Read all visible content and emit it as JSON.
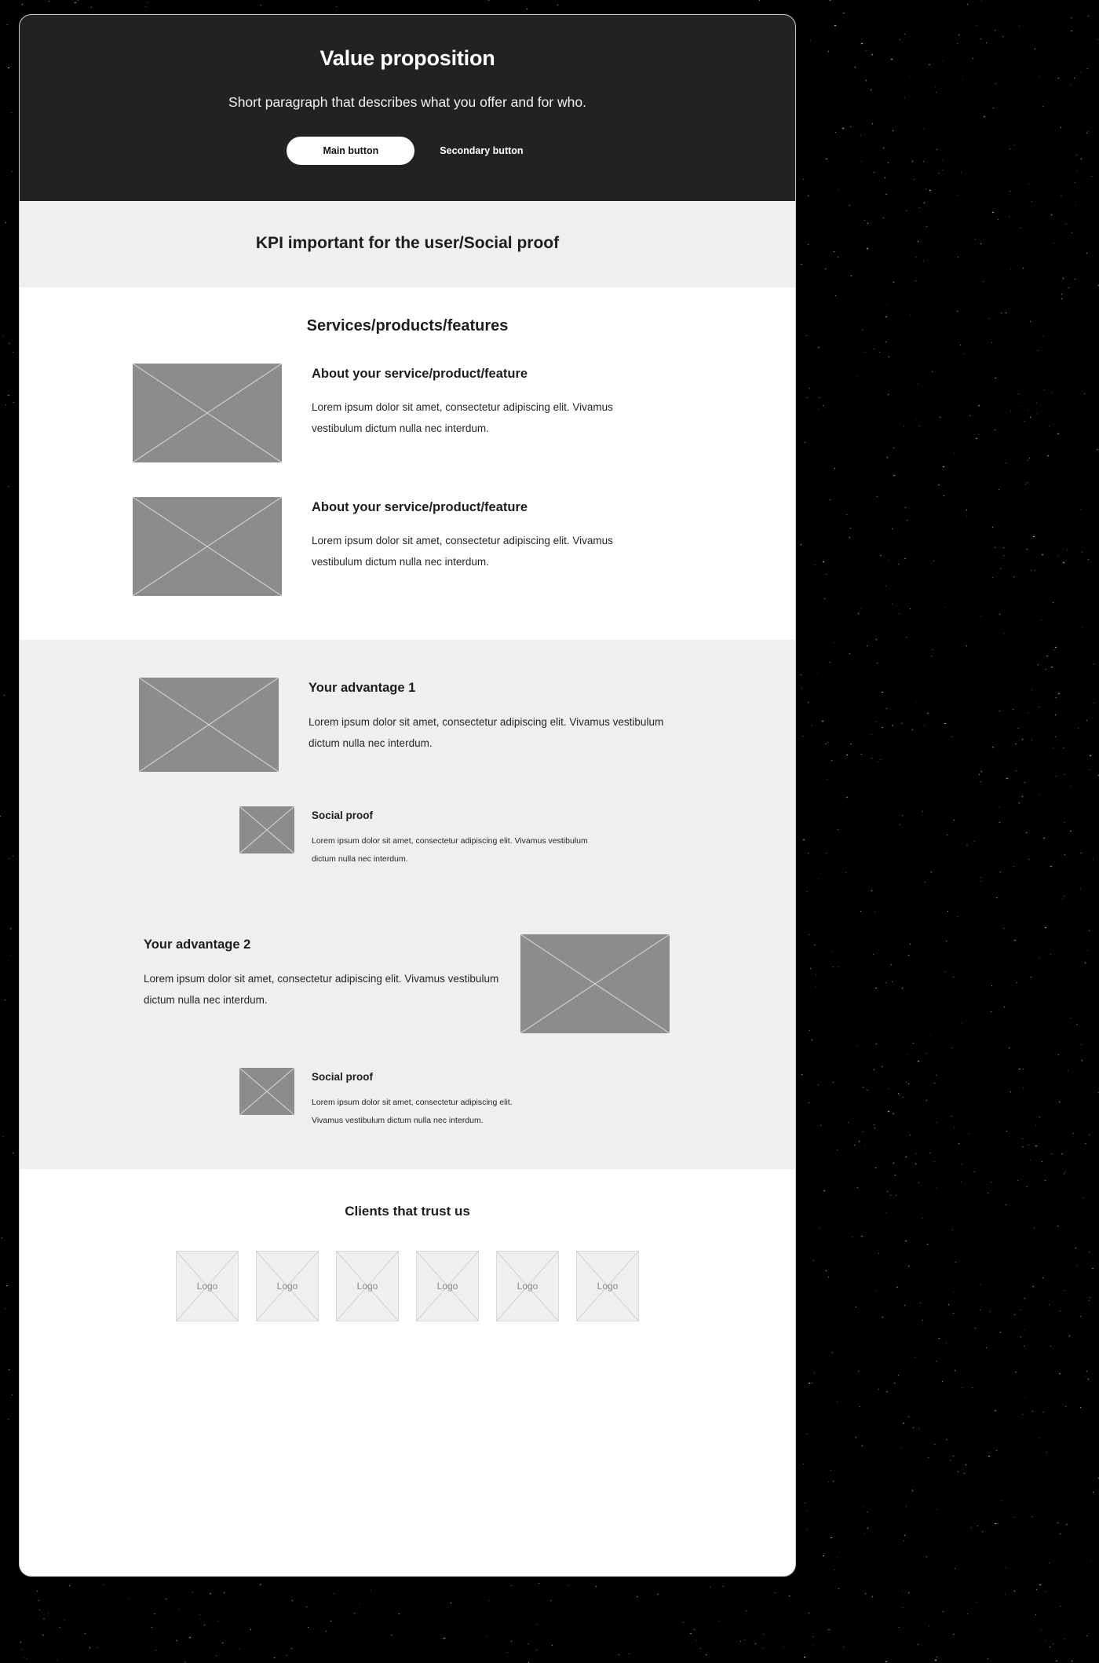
{
  "hero": {
    "title": "Value proposition",
    "subtitle": "Short paragraph that describes what you offer and for who.",
    "primary_button": "Main button",
    "secondary_button": "Secondary button",
    "background_color": "#222222"
  },
  "kpi_band": {
    "text": "KPI important for the user/Social proof",
    "background_color": "#efefef"
  },
  "services": {
    "heading": "Services/products/features",
    "items": [
      {
        "title": "About your service/product/feature",
        "text": "Lorem ipsum dolor sit amet, consectetur adipiscing elit. Vivamus vestibulum dictum nulla nec interdum.",
        "image_placeholder": "image-placeholder"
      },
      {
        "title": "About your service/product/feature",
        "text": "Lorem ipsum dolor sit amet, consectetur adipiscing elit. Vivamus vestibulum dictum nulla nec interdum.",
        "image_placeholder": "image-placeholder"
      }
    ]
  },
  "advantages": {
    "background_color": "#efefef",
    "advantage_one": {
      "title": "Your advantage 1",
      "text": "Lorem ipsum dolor sit amet, consectetur adipiscing elit. Vivamus vestibulum dictum nulla nec interdum.",
      "image_placeholder": "image-placeholder"
    },
    "social_proof_one": {
      "title": "Social proof",
      "text": "Lorem ipsum dolor sit amet, consectetur adipiscing elit. Vivamus vestibulum dictum nulla nec interdum.",
      "image_placeholder": "image-placeholder"
    },
    "advantage_two": {
      "title": "Your advantage 2",
      "text": "Lorem ipsum dolor sit amet, consectetur adipiscing elit. Vivamus vestibulum dictum nulla nec interdum.",
      "image_placeholder": "image-placeholder"
    },
    "social_proof_two": {
      "title": "Social proof",
      "line_one": "Lorem ipsum dolor sit amet, consectetur adipiscing elit.",
      "line_two": "Vivamus vestibulum dictum nulla nec interdum.",
      "image_placeholder": "image-placeholder"
    }
  },
  "clients": {
    "heading": "Clients that trust us",
    "logos": [
      {
        "label": "Logo"
      },
      {
        "label": "Logo"
      },
      {
        "label": "Logo"
      },
      {
        "label": "Logo"
      },
      {
        "label": "Logo"
      },
      {
        "label": "Logo"
      }
    ]
  },
  "colors": {
    "page_background": "#000000",
    "card_background": "#ffffff",
    "dark_section": "#222222",
    "light_section": "#efefef",
    "placeholder_fill": "#8c8c8c",
    "logo_fill": "#efefef",
    "text_primary": "#1d1d1d"
  }
}
